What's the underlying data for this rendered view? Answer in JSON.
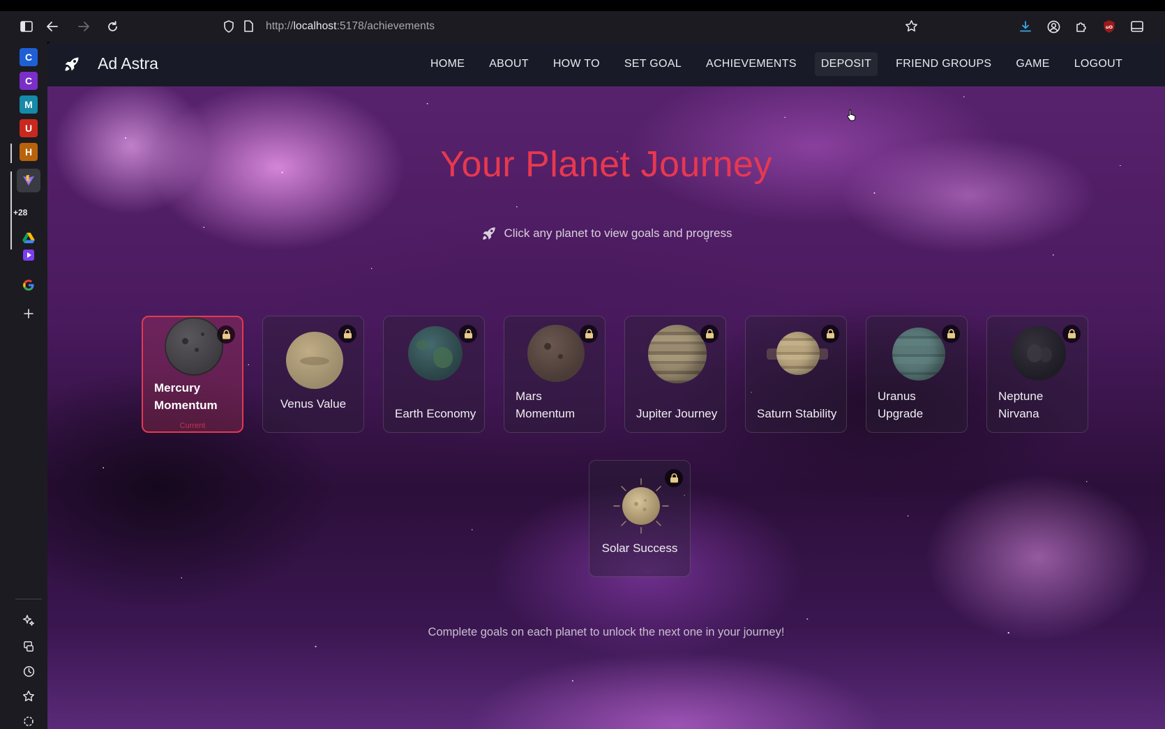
{
  "browser": {
    "url_prefix": "http://",
    "url_host": "localhost",
    "url_rest": ":5178/achievements"
  },
  "sidebar": {
    "tiles": [
      {
        "letter": "C",
        "color": "#1f5fd6"
      },
      {
        "letter": "C",
        "color": "#7a2fc9"
      },
      {
        "letter": "M",
        "color": "#168aa8"
      },
      {
        "letter": "U",
        "color": "#c8281e"
      },
      {
        "letter": "H",
        "color": "#b8620c"
      }
    ],
    "more_count": "+28"
  },
  "app": {
    "brand": "Ad Astra",
    "nav": [
      "HOME",
      "ABOUT",
      "HOW TO",
      "SET GOAL",
      "ACHIEVEMENTS",
      "DEPOSIT",
      "FRIEND GROUPS",
      "GAME",
      "LOGOUT"
    ],
    "title": "Your Planet Journey",
    "hint": "Click any planet to view goals and progress",
    "planets": [
      {
        "name": "Mercury Momentum",
        "state": "current",
        "current_label": "Current",
        "color": "#4d4a4f"
      },
      {
        "name": "Venus Value",
        "state": "locked",
        "color": "#a89878"
      },
      {
        "name": "Earth Economy",
        "state": "locked",
        "color": "#3a5a58"
      },
      {
        "name": "Mars Momentum",
        "state": "locked",
        "color": "#5a4944"
      },
      {
        "name": "Jupiter Journey",
        "state": "locked",
        "color": "#8e8067"
      },
      {
        "name": "Saturn Stability",
        "state": "locked",
        "color": "#a8966e"
      },
      {
        "name": "Uranus Upgrade",
        "state": "locked",
        "color": "#4f6d6e"
      },
      {
        "name": "Neptune Nirvana",
        "state": "locked",
        "color": "#2a2832"
      },
      {
        "name": "Solar Success",
        "state": "locked",
        "color": "#c2ad82"
      }
    ],
    "footer": "Complete goals on each planet to unlock the next one in your journey!",
    "accent": "#e8384f"
  }
}
